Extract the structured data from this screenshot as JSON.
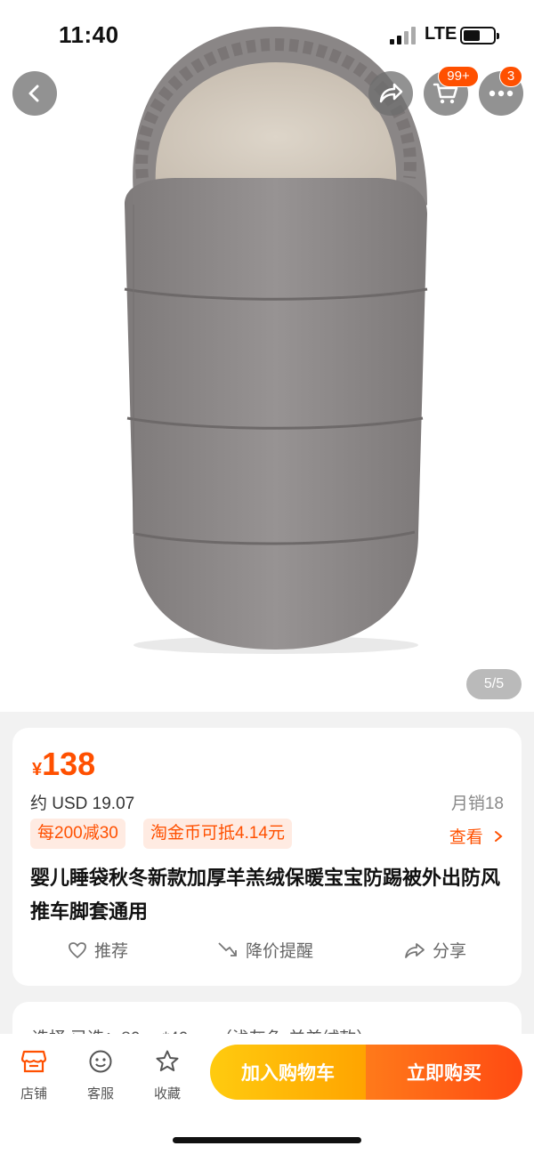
{
  "status_bar": {
    "time": "11:40",
    "network": "LTE"
  },
  "header": {
    "back_icon": "chevron-left-icon",
    "share_icon": "share-arrow-icon",
    "cart_icon": "cart-icon",
    "cart_badge": "99+",
    "more_icon": "more-dots-icon",
    "more_badge": "3"
  },
  "gallery": {
    "indicator": "5/5"
  },
  "product": {
    "currency_symbol": "¥",
    "price": "138",
    "usd_price": "约 USD 19.07",
    "monthly_sales": "月销18",
    "promo_tags": [
      "每200减30",
      "淘金币可抵4.14元"
    ],
    "view_link": "查看",
    "title": "婴儿睡袋秋冬新款加厚羊羔绒保暖宝宝防踢被外出防风推车脚套通用"
  },
  "actions": [
    {
      "label": "推荐",
      "icon": "heart-icon"
    },
    {
      "label": "降价提醒",
      "icon": "price-drop-icon"
    },
    {
      "label": "分享",
      "icon": "share-icon"
    }
  ],
  "selection_hint": "选择    已选：80cm*40cm （浅灰色-羊羔绒款）",
  "bottom_nav": [
    {
      "label": "店铺",
      "icon": "shop-icon"
    },
    {
      "label": "客服",
      "icon": "customer-service-icon"
    },
    {
      "label": "收藏",
      "icon": "star-icon"
    }
  ],
  "buttons": {
    "add_to_cart": "加入购物车",
    "buy_now": "立即购买"
  },
  "colors": {
    "accent": "#ff5000",
    "cart_button": "#ffb300",
    "buy_button": "#ff5a14"
  }
}
